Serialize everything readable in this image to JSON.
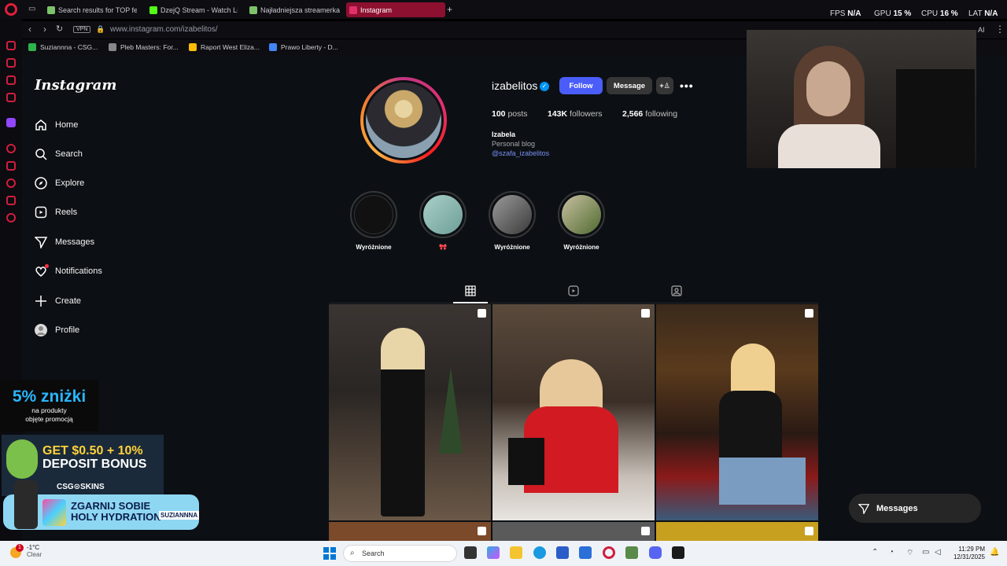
{
  "browser": {
    "tabs": [
      {
        "label": "Search results for TOP fe",
        "color": "#7cc36a"
      },
      {
        "label": "DzejQ Stream - Watch Liv",
        "color": "#53fc18"
      },
      {
        "label": "Najładniejsza streamerka",
        "color": "#7cc36a"
      },
      {
        "label": "Instagram",
        "color": "#e1306c"
      }
    ],
    "new_tab_symbol": "+",
    "url": "www.instagram.com/izabelitos/",
    "vpn_label": "VPN",
    "stats": {
      "fps_label": "FPS",
      "fps_value": "N/A",
      "gpu_label": "GPU",
      "gpu_value": "15 %",
      "cpu_label": "CPU",
      "cpu_value": "16 %",
      "lat_label": "LAT",
      "lat_value": "N/A"
    },
    "toolbar_ai_label": "AI",
    "bookmarks": [
      {
        "label": "Suziannna - CSG...",
        "color": "#2fb34a"
      },
      {
        "label": "Pleb Masters: For...",
        "color": "#888888"
      },
      {
        "label": "Raport West Eliza...",
        "color": "#fbbc04"
      },
      {
        "label": "Prawo Liberty - D...",
        "color": "#4285f4"
      }
    ]
  },
  "instagram": {
    "logo": "Instagram",
    "nav": [
      {
        "label": "Home",
        "icon": "home-icon"
      },
      {
        "label": "Search",
        "icon": "search-icon"
      },
      {
        "label": "Explore",
        "icon": "compass-icon"
      },
      {
        "label": "Reels",
        "icon": "reels-icon"
      },
      {
        "label": "Messages",
        "icon": "messenger-icon"
      },
      {
        "label": "Notifications",
        "icon": "heart-icon"
      },
      {
        "label": "Create",
        "icon": "plus-icon"
      },
      {
        "label": "Profile",
        "icon": "avatar-icon"
      }
    ],
    "profile": {
      "username": "izabelitos",
      "verified": true,
      "follow_label": "Follow",
      "message_label": "Message",
      "posts_count": "100",
      "posts_label": "posts",
      "followers_count": "143K",
      "followers_label": "followers",
      "following_count": "2,566",
      "following_label": "following",
      "full_name": "Izabela",
      "category": "Personal blog",
      "link": "@szafa_izabelitos"
    },
    "highlights": [
      {
        "label": "Wyróżnione",
        "color": "#111111"
      },
      {
        "label": "🎀",
        "color": "#8fbfb8"
      },
      {
        "label": "Wyróżnione",
        "color": "#6a6a6a"
      },
      {
        "label": "Wyróżnione",
        "color": "#7a8a5a"
      }
    ],
    "floating_messages_label": "Messages"
  },
  "ads": {
    "discount_big": "5% zniżki",
    "discount_small_1": "na produkty",
    "discount_small_2": "objęte promocją",
    "bonus_line1": "GET $0.50 + 10%",
    "bonus_line2": "DEPOSIT BONUS",
    "bonus_brand": "CSG⊙SKINS",
    "hydration_line1": "ZGARNIJ SOBIE",
    "hydration_line2": "HOLY HYDRATION",
    "hydration_badge": "SUZIANNNA"
  },
  "taskbar": {
    "weather_temp": "-1°C",
    "weather_desc": "Clear",
    "weather_badge": "1",
    "search_placeholder": "Search",
    "time": "11:29 PM",
    "date": "12/31/2025"
  },
  "colors": {
    "ig_bg": "#0c1014",
    "follow_blue": "#4a5df9",
    "opera_red": "#e0203a"
  }
}
